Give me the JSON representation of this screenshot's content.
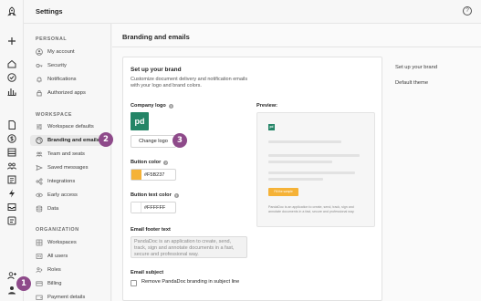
{
  "header": {
    "title": "Settings",
    "help_icon": "question-circle-icon"
  },
  "rail": {
    "icons": [
      "rocket-icon",
      "plus-icon",
      "home-icon",
      "check-circle-icon",
      "bar-chart-icon",
      "document-icon",
      "dollar-icon",
      "template-icon",
      "contacts-icon",
      "catalog-icon",
      "bolt-icon",
      "inbox-icon",
      "forms-icon",
      "add-user-icon",
      "account-icon"
    ]
  },
  "settings_nav": {
    "sections": [
      {
        "title": "PERSONAL",
        "items": [
          {
            "label": "My account",
            "icon": "user-circle-icon"
          },
          {
            "label": "Security",
            "icon": "key-icon"
          },
          {
            "label": "Notifications",
            "icon": "bell-icon"
          },
          {
            "label": "Authorized apps",
            "icon": "lock-icon"
          }
        ]
      },
      {
        "title": "WORKSPACE",
        "items": [
          {
            "label": "Workspace defaults",
            "icon": "sliders-icon"
          },
          {
            "label": "Branding and emails",
            "icon": "palette-icon",
            "active": true
          },
          {
            "label": "Team and seats",
            "icon": "team-icon"
          },
          {
            "label": "Saved messages",
            "icon": "send-icon"
          },
          {
            "label": "Integrations",
            "icon": "integrations-icon"
          },
          {
            "label": "Early access",
            "icon": "eye-icon"
          },
          {
            "label": "Data",
            "icon": "database-icon"
          }
        ]
      },
      {
        "title": "ORGANIZATION",
        "items": [
          {
            "label": "Workspaces",
            "icon": "workspaces-icon"
          },
          {
            "label": "All users",
            "icon": "users-icon"
          },
          {
            "label": "Roles",
            "icon": "roles-icon"
          },
          {
            "label": "Billing",
            "icon": "card-icon"
          },
          {
            "label": "Payment details",
            "icon": "wallet-icon"
          }
        ]
      }
    ]
  },
  "main": {
    "page_title": "Branding and emails",
    "card": {
      "heading": "Set up your brand",
      "description": "Customize document delivery and notification emails with your logo and brand colors.",
      "company_logo_label": "Company logo",
      "logo_text": "pd",
      "change_logo_button": "Change logo",
      "button_color_label": "Button color",
      "button_color_value": "#F5B237",
      "button_color_hex": "#F5B237",
      "button_text_color_label": "Button text color",
      "button_text_color_value": "#FFFFFF",
      "button_text_color_hex": "#FFFFFF",
      "email_footer_label": "Email footer text",
      "email_footer_placeholder": "PandaDoc is an application to create, send, track, sign and annotate documents in a fast, secure and professional way.",
      "email_subject_label": "Email subject",
      "remove_branding_label": "Remove PandaDoc branding in subject line",
      "preview_label": "Preview:",
      "preview_logo_text": "pd",
      "preview_button_text": "Fill the sample",
      "preview_footer": "PandaDoc is an application to create, send, track, sign and annotate documents in a fast, secure and professional way."
    },
    "toc": [
      "Set up your brand",
      "Default theme"
    ]
  },
  "badges": [
    "1",
    "2",
    "3"
  ],
  "colors": {
    "brand_green": "#248567",
    "accent_orange": "#F5B237",
    "badge_purple": "#8E4A8A"
  }
}
